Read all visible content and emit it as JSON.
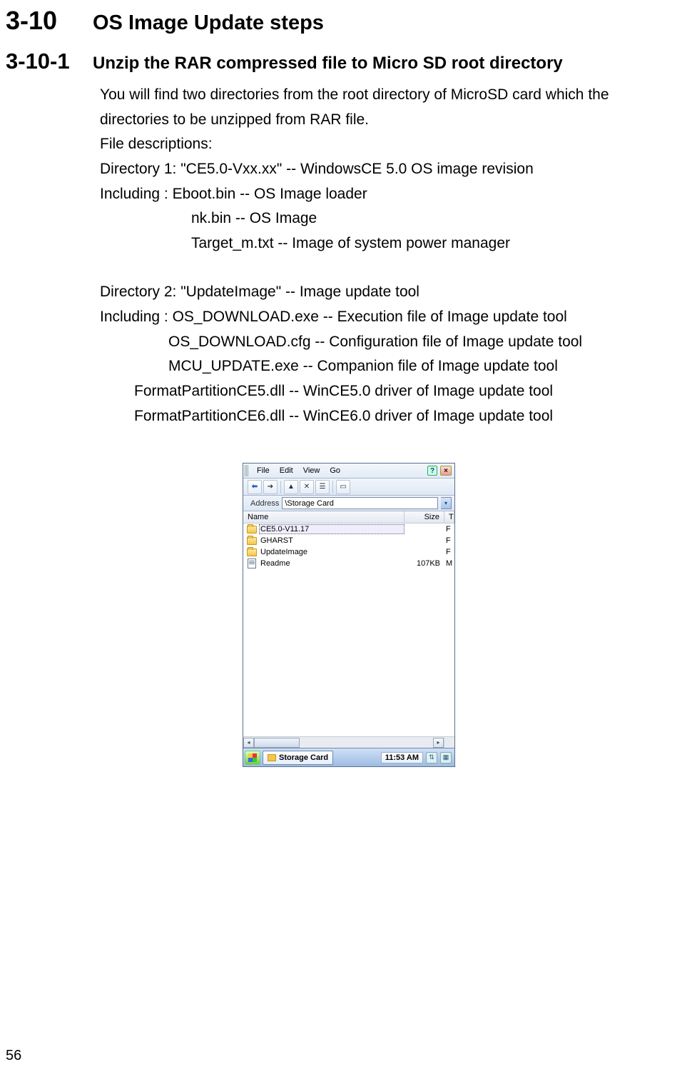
{
  "section": {
    "number": "3-10",
    "title": "OS Image Update steps"
  },
  "subsection": {
    "number": "3-10-1",
    "title": "Unzip the RAR compressed file to Micro SD root directory"
  },
  "body": {
    "intro1": "You will find two directories from the root directory of MicroSD card which the",
    "intro2": "directories to be unzipped from RAR file.",
    "filedesc": "File descriptions:",
    "dir1": "Directory 1: \"CE5.0-Vxx.xx\"    -- WindowsCE 5.0 OS image revision",
    "inc1": "Including   : Eboot.bin           -- OS Image loader",
    "nk": "nk.bin           -- OS Image",
    "target": "Target_m.txt     -- Image of system power manager",
    "dir2": "Directory 2: \"UpdateImage\"               -- Image update tool",
    "inc2": "Including   : OS_DOWNLOAD.exe     -- Execution file of Image update tool",
    "cfg": "OS_DOWNLOAD.cfg     -- Configuration file of Image update tool",
    "mcu": "MCU_UPDATE.exe            -- Companion file of Image update tool",
    "fp5": "FormatPartitionCE5.dll     -- WinCE5.0 driver of Image update tool",
    "fp6": "FormatPartitionCE6.dll     -- WinCE6.0 driver of Image update tool"
  },
  "wince": {
    "menu": {
      "file": "File",
      "edit": "Edit",
      "view": "View",
      "go": "Go"
    },
    "help_icon": "?",
    "close_icon": "×",
    "address_label": "Address",
    "address_value": "\\Storage Card",
    "columns": {
      "name": "Name",
      "size": "Size",
      "t": "T"
    },
    "rows": [
      {
        "icon": "folder",
        "name": "CE5.0-V11.17",
        "size": "",
        "t": "F",
        "selected": true
      },
      {
        "icon": "folder",
        "name": "GHARST",
        "size": "",
        "t": "F",
        "selected": false
      },
      {
        "icon": "folder",
        "name": "UpdateImage",
        "size": "",
        "t": "F",
        "selected": false
      },
      {
        "icon": "doc",
        "name": "Readme",
        "size": "107KB",
        "t": "M",
        "selected": false
      }
    ],
    "taskbar": {
      "button": "Storage Card",
      "clock": "11:53 AM"
    }
  },
  "page_number": "56"
}
